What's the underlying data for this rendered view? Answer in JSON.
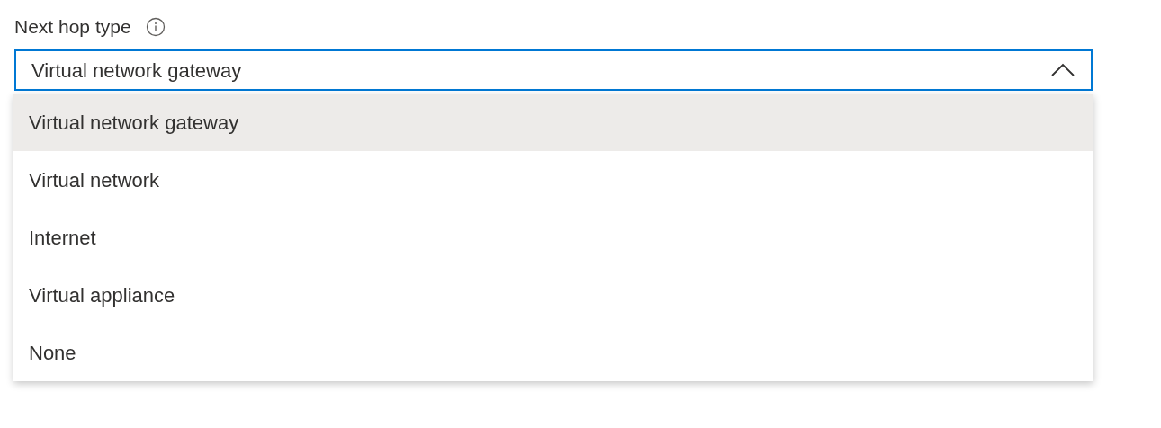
{
  "field": {
    "label": "Next hop type",
    "value": "Virtual network gateway",
    "expanded": true
  },
  "options": [
    {
      "label": "Virtual network gateway",
      "selected": true
    },
    {
      "label": "Virtual network",
      "selected": false
    },
    {
      "label": "Internet",
      "selected": false
    },
    {
      "label": "Virtual appliance",
      "selected": false
    },
    {
      "label": "None",
      "selected": false
    }
  ]
}
